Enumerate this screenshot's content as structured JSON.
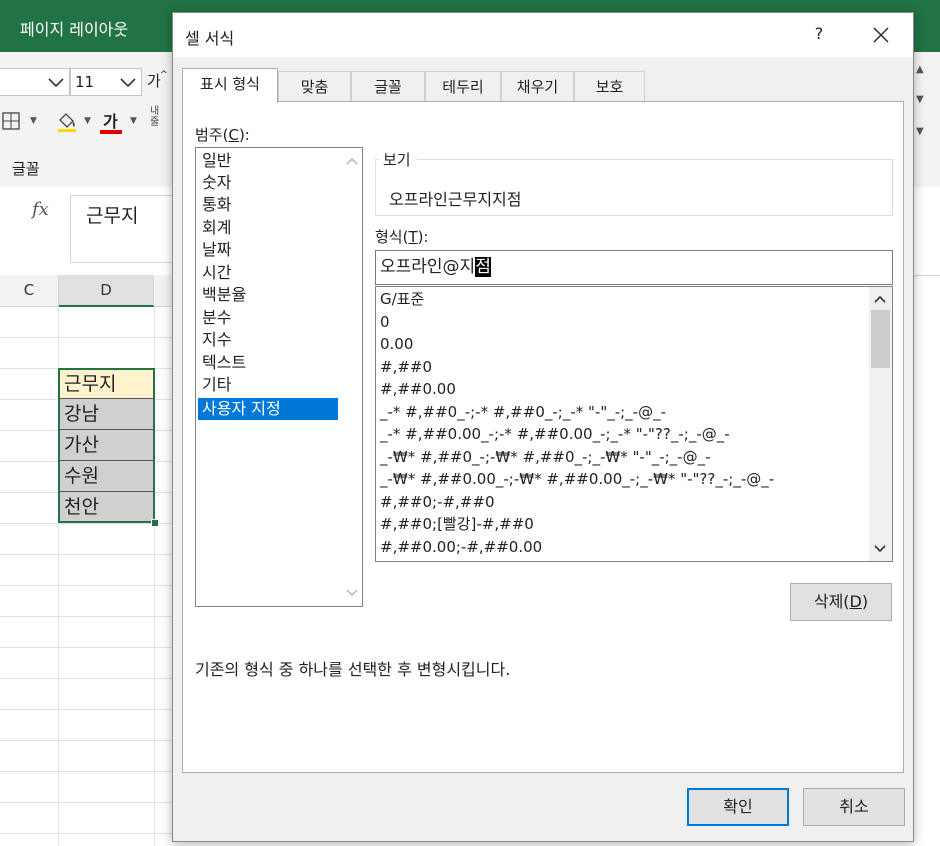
{
  "excel": {
    "title_text": "페이지 레이아웃",
    "font_size": "11",
    "grow_font": "가",
    "font_color_glyph": "가",
    "truncated_label": "내\n줄",
    "group_label": "글꼴",
    "fx_label": "fx",
    "formula_value": "근무지",
    "columns": [
      "C",
      "D"
    ],
    "cells": [
      "근무지",
      "강남",
      "가산",
      "수원",
      "천안"
    ]
  },
  "dialog": {
    "title": "셀 서식",
    "help_label": "?",
    "tabs": [
      "표시 형식",
      "맞춤",
      "글꼴",
      "테두리",
      "채우기",
      "보호"
    ],
    "category_label": "범주(",
    "category_key": "C",
    "category_label_end": "):",
    "categories": [
      "일반",
      "숫자",
      "통화",
      "회계",
      "날짜",
      "시간",
      "백분율",
      "분수",
      "지수",
      "텍스트",
      "기타",
      "사용자 지정"
    ],
    "selected_category": "사용자 지정",
    "preview_label": "보기",
    "preview_value": "오프라인근무지지점",
    "format_label": "형식(",
    "format_key": "T",
    "format_label_end": "):",
    "format_input_plain": "오프라인@지",
    "format_input_highlight": "점",
    "format_list": [
      "G/표준",
      "0",
      "0.00",
      "#,##0",
      "#,##0.00",
      "_-* #,##0_-;-* #,##0_-;_-* \"-\"_-;_-@_-",
      "_-* #,##0.00_-;-* #,##0.00_-;_-* \"-\"??_-;_-@_-",
      "_-₩* #,##0_-;-₩* #,##0_-;_-₩* \"-\"_-;_-@_-",
      "_-₩* #,##0.00_-;-₩* #,##0.00_-;_-₩* \"-\"??_-;_-@_-",
      "#,##0;-#,##0",
      "#,##0;[빨강]-#,##0",
      "#,##0.00;-#,##0.00"
    ],
    "delete_label": "삭제(",
    "delete_key": "D",
    "delete_label_end": ")",
    "description": "기존의 형식 중 하나를 선택한 후 변형시킵니다.",
    "ok_label": "확인",
    "cancel_label": "취소"
  },
  "colors": {
    "excel_green": "#217346",
    "selection_blue": "#0078d7"
  },
  "icons": [
    "chevron-down-icon",
    "borders-icon",
    "fill-color-icon",
    "font-color-icon",
    "close-icon",
    "scroll-up-icon",
    "scroll-down-icon"
  ]
}
